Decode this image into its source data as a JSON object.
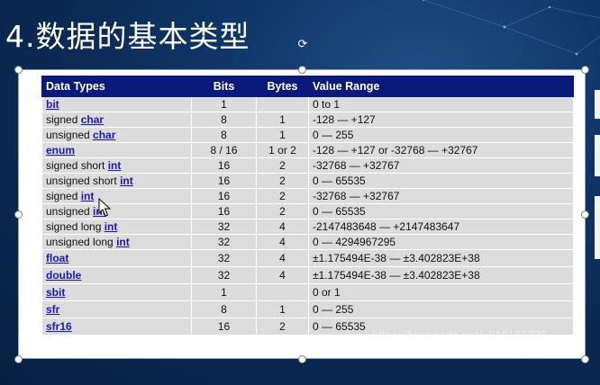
{
  "slide": {
    "title": "4.数据的基本类型"
  },
  "table": {
    "headers": {
      "type": "Data Types",
      "bits": "Bits",
      "bytes": "Bytes",
      "range": "Value Range"
    },
    "rows": [
      {
        "prefix": "",
        "kw": "bit",
        "bits": "1",
        "bytes": "",
        "range": "0 to 1"
      },
      {
        "prefix": "signed ",
        "kw": "char",
        "bits": "8",
        "bytes": "1",
        "range": "-128 — +127"
      },
      {
        "prefix": "unsigned ",
        "kw": "char",
        "bits": "8",
        "bytes": "1",
        "range": "0 — 255"
      },
      {
        "prefix": "",
        "kw": "enum",
        "bits": "8 / 16",
        "bytes": "1 or 2",
        "range": "-128 — +127 or -32768 — +32767"
      },
      {
        "prefix": "signed short ",
        "kw": "int",
        "bits": "16",
        "bytes": "2",
        "range": "-32768 — +32767"
      },
      {
        "prefix": "unsigned short ",
        "kw": "int",
        "bits": "16",
        "bytes": "2",
        "range": "0 — 65535"
      },
      {
        "prefix": "signed ",
        "kw": "int",
        "bits": "16",
        "bytes": "2",
        "range": "-32768 — +32767"
      },
      {
        "prefix": "unsigned ",
        "kw": "int",
        "bits": "16",
        "bytes": "2",
        "range": "0 — 65535"
      },
      {
        "prefix": "signed long ",
        "kw": "int",
        "bits": "32",
        "bytes": "4",
        "range": "-2147483648 — +2147483647"
      },
      {
        "prefix": "unsigned long ",
        "kw": "int",
        "bits": "32",
        "bytes": "4",
        "range": "0 — 4294967295"
      },
      {
        "prefix": "",
        "kw": "float",
        "bits": "32",
        "bytes": "4",
        "range": "±1.175494E-38 — ±3.402823E+38"
      },
      {
        "prefix": "",
        "kw": "double",
        "bits": "32",
        "bytes": "4",
        "range": "±1.175494E-38 — ±3.402823E+38"
      },
      {
        "prefix": "",
        "kw": "sbit",
        "bits": "1",
        "bytes": "",
        "range": "0 or 1"
      },
      {
        "prefix": "",
        "kw": "sfr",
        "bits": "8",
        "bytes": "1",
        "range": "0 — 255"
      },
      {
        "prefix": "",
        "kw": "sfr16",
        "bits": "16",
        "bytes": "2",
        "range": "0 — 65535"
      }
    ]
  },
  "watermark": "https://blog.csdn.net/u010160335",
  "colors": {
    "header_bg": "#0a1a7a",
    "row_bg": "#dcdcdc",
    "keyword": "#1a1aa8",
    "slide_bg": "#0f3566"
  },
  "icons": {
    "rotate": "rotate-handle-icon",
    "cursor": "move-cursor-icon"
  }
}
